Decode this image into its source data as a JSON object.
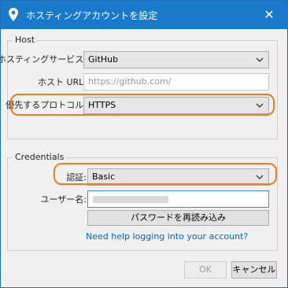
{
  "window": {
    "title": "ホスティングアカウントを設定",
    "close_glyph": "✕"
  },
  "host": {
    "group_title": "Host",
    "service_label": "ホスティングサービス:",
    "service_value": "GitHub",
    "url_label": "ホスト URL:",
    "url_placeholder": "https://github.com/",
    "protocol_label": "優先するプロトコル:",
    "protocol_value": "HTTPS"
  },
  "credentials": {
    "group_title": "Credentials",
    "auth_label": "認証:",
    "auth_value": "Basic",
    "username_label": "ユーザー名:",
    "reload_password_button": "パスワードを再読み込み",
    "help_link": "Need help logging into your account?"
  },
  "footer": {
    "ok_label": "OK",
    "cancel_label": "キャンセル"
  },
  "colors": {
    "titlebar": "#1979ca",
    "highlight": "#f07c1e",
    "link": "#0066cc"
  },
  "icons": {
    "app": "location-pin-icon",
    "close": "close-icon",
    "chevron": "chevron-down-icon"
  }
}
